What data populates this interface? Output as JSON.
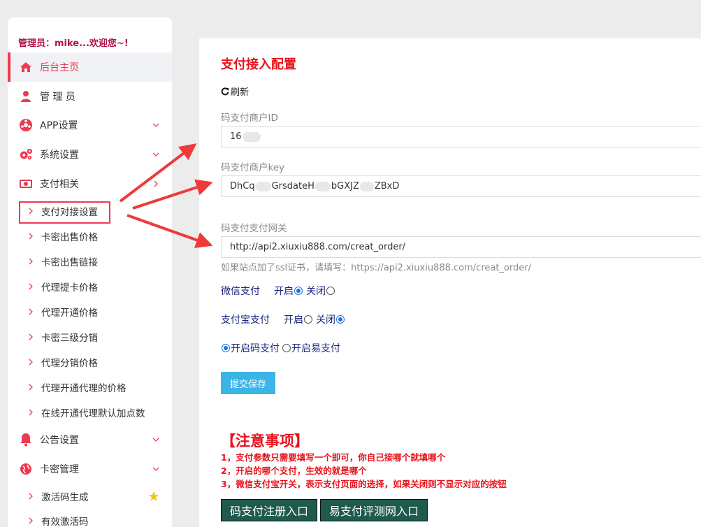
{
  "sidebar": {
    "admin_greeting": "管理员：mike...欢迎您~!",
    "items": [
      {
        "label": "后台主页",
        "icon": "home-icon"
      },
      {
        "label": "管 理 员",
        "icon": "user-icon"
      },
      {
        "label": "APP设置",
        "icon": "app-icon"
      },
      {
        "label": "系统设置",
        "icon": "gears-icon"
      },
      {
        "label": "支付相关",
        "icon": "money-icon"
      },
      {
        "label": "公告设置",
        "icon": "bell-icon"
      },
      {
        "label": "卡密管理",
        "icon": "globe-icon"
      }
    ],
    "pay_sub": [
      "支付对接设置",
      "卡密出售价格",
      "卡密出售链接",
      "代理提卡价格",
      "代理开通价格",
      "卡密三级分销",
      "代理分销价格",
      "代理开通代理的价格",
      "在线开通代理默认加点数"
    ],
    "card_sub": [
      "激活码生成",
      "有效激活码"
    ]
  },
  "main": {
    "title": "支付接入配置",
    "refresh_label": "刷新",
    "merchant_id_label": "码支付商户ID",
    "merchant_id_value": "16",
    "merchant_key_label": "码支付商户key",
    "merchant_key_parts": [
      "DhCq",
      "GrsdateH",
      "bGXJZ",
      "ZBxD"
    ],
    "gateway_label": "码支付支付网关",
    "gateway_value": "http://api2.xiuxiu888.com/creat_order/",
    "ssl_hint": "如果站点加了ssl证书，请填写：https://api2.xiuxiu888.com/creat_order/",
    "wechat_label": "微信支付",
    "alipay_label": "支付宝支付",
    "on_label": "开启",
    "off_label": "关闭",
    "wechat_enabled": true,
    "alipay_enabled": false,
    "mode_code_pay": "开启码支付",
    "mode_easy_pay": "开启易支付",
    "selected_mode": "code_pay",
    "submit_label": "提交保存",
    "notice_title": "【注意事项】",
    "notice_lines": [
      "1，支付参数只需要填写一个即可，你自己接哪个就填哪个",
      "2，开启的哪个支付，生效的就是哪个",
      "3，微信支付宝开关，表示支付页面的选择，如果关闭则不显示对应的按钮"
    ],
    "register_button": "码支付注册入口",
    "review_button": "易支付评测网入口"
  },
  "colors": {
    "accent": "#ee3a51",
    "title_red": "#e8121b",
    "submit_blue": "#3bb4e6",
    "entry_green": "#1f5a4c",
    "admin_text": "#b0124a"
  }
}
